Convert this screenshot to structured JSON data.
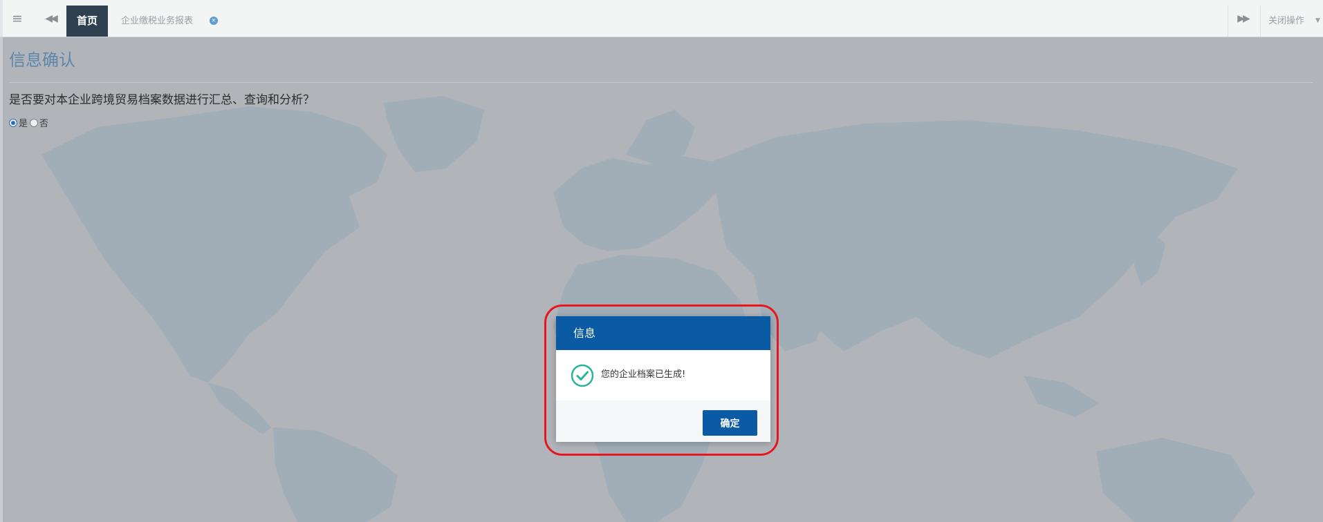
{
  "topbar": {
    "menu_icon": "menu-icon",
    "back_icon": "double-chevron-left-icon",
    "forward_icon": "double-chevron-right-icon",
    "home_tab": "首页",
    "report_tab": "企业缴税业务报表",
    "close_operations": "关闭操作"
  },
  "page": {
    "title": "信息确认",
    "question": "是否要对本企业跨境贸易档案数据进行汇总、查询和分析？",
    "options": [
      {
        "label": "是",
        "selected": true
      },
      {
        "label": "否",
        "selected": false
      }
    ]
  },
  "dialog": {
    "title": "信息",
    "message": "您的企业档案已生成!",
    "confirm": "确定",
    "icon": "check-circle-icon"
  },
  "colors": {
    "accent": "#0b5ba4",
    "home_tab_bg": "#2f4050",
    "highlight": "#e8161c",
    "success": "#28b49a",
    "title": "#5d86ac"
  }
}
